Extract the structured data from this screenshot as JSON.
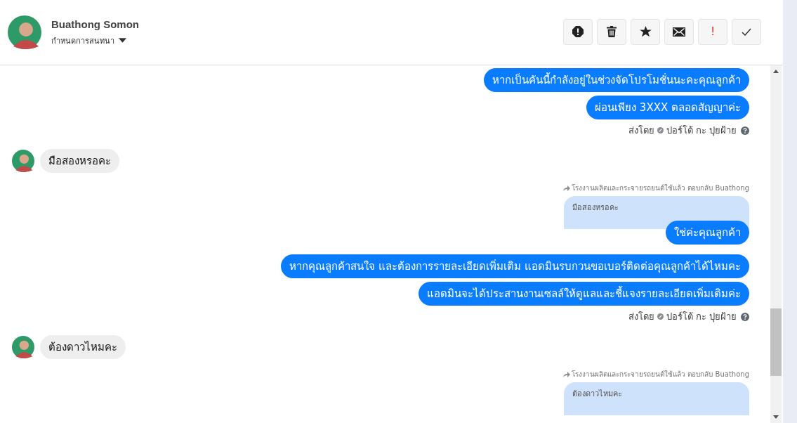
{
  "header": {
    "name": "Buathong Somon",
    "subtitle": "กำหนดการสนทนา"
  },
  "actions": [
    {
      "kind": "alert"
    },
    {
      "kind": "trash"
    },
    {
      "kind": "star"
    },
    {
      "kind": "mail"
    },
    {
      "kind": "text",
      "label": "!"
    },
    {
      "kind": "check"
    }
  ],
  "messages": [
    {
      "kind": "out",
      "text": "หากเป็นคันนี้กำลังอยู่ในช่วงจัดโปรโมชั่นนะคะคุณลูกค้า"
    },
    {
      "kind": "out",
      "text": "ผ่อนเพียง 3XXX ตลอดสัญญาค่ะ"
    },
    {
      "kind": "sent_by",
      "label": "ส่งโดย",
      "sender": "ปอร์โต้ กะ ปุยฝ้าย"
    },
    {
      "kind": "in",
      "text": "มือสองหรอคะ"
    },
    {
      "kind": "reply",
      "note": "โรงงานผลิตและกระจายรถยนต์ใช้แล้ว ตอบกลับ Buathong",
      "quote": "มือสองหรอคะ",
      "text": "ใช่ค่ะคุณลูกค้า"
    },
    {
      "kind": "out",
      "text": "หากคุณลูกค้าสนใจ และต้องการรายละเอียดเพิ่มเติม แอดมินรบกวนขอเบอร์ติดต่อคุณลูกค้าได้ไหมคะ"
    },
    {
      "kind": "out",
      "text": "แอดมินจะได้ประสานงานเซลล์ให้ดูแลและชี้แจงรายละเอียดเพิ่มเติมค่ะ"
    },
    {
      "kind": "sent_by",
      "label": "ส่งโดย",
      "sender": "ปอร์โต้ กะ ปุยฝ้าย"
    },
    {
      "kind": "in",
      "text": "ต้องดาวไหมคะ"
    },
    {
      "kind": "reply",
      "note": "โรงงานผลิตและกระจายรถยนต์ใช้แล้ว ตอบกลับ Buathong",
      "quote": "ต้องดาวไหมคะ"
    }
  ]
}
